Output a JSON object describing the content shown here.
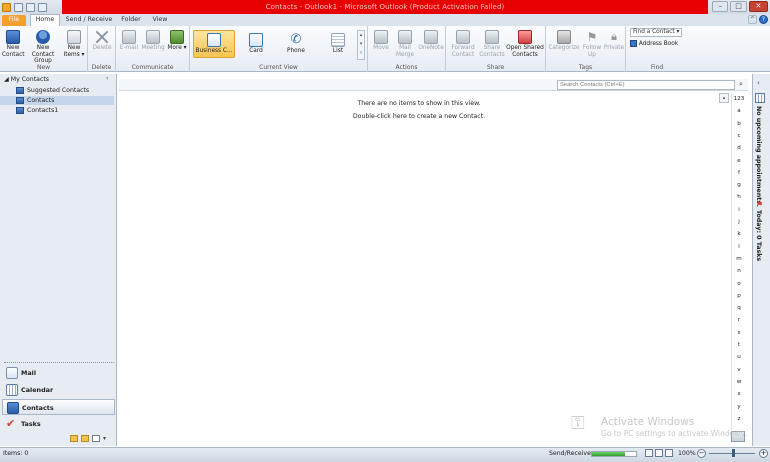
{
  "window": {
    "title": "Contacts - Outlook1 - Microsoft Outlook (Product Activation Failed)"
  },
  "tabs": [
    "File",
    "Home",
    "Send / Receive",
    "Folder",
    "View"
  ],
  "ribbon": {
    "new": {
      "new_contact": "New Contact",
      "new_group": "New Contact Group",
      "new_items": "New Items",
      "label": "New"
    },
    "delete": {
      "delete": "Delete",
      "label": "Delete"
    },
    "communicate": {
      "email": "E-mail",
      "meeting": "Meeting",
      "more": "More",
      "label": "Communicate"
    },
    "current_view": {
      "business_card": "Business C...",
      "card": "Card",
      "phone": "Phone",
      "list": "List",
      "label": "Current View"
    },
    "actions": {
      "move": "Move",
      "mail_merge": "Mail Merge",
      "onenote": "OneNote",
      "label": "Actions"
    },
    "share": {
      "forward_contact": "Forward Contact",
      "share_contacts": "Share Contacts",
      "open_shared": "Open Shared Contacts",
      "label": "Share"
    },
    "tags": {
      "categorize": "Categorize",
      "follow_up": "Follow Up",
      "private": "Private",
      "label": "Tags"
    },
    "find": {
      "find_contact": "Find a Contact",
      "address_book": "Address Book",
      "label": "Find"
    }
  },
  "nav": {
    "title": "My Contacts",
    "folders": [
      "Suggested Contacts",
      "Contacts",
      "Contacts1"
    ],
    "selected_folder": "Contacts",
    "buttons": [
      "Mail",
      "Calendar",
      "Contacts",
      "Tasks"
    ],
    "selected_button": "Contacts"
  },
  "main": {
    "search_placeholder": "Search Contacts (Ctrl+E)",
    "empty_message": "There are no items to show in this view.",
    "create_message": "Double-click here to create a new Contact.",
    "alphabet": [
      "123",
      "a",
      "b",
      "c",
      "d",
      "e",
      "f",
      "g",
      "h",
      "i",
      "j",
      "k",
      "l",
      "m",
      "n",
      "o",
      "p",
      "q",
      "r",
      "s",
      "t",
      "u",
      "v",
      "w",
      "x",
      "y",
      "z"
    ]
  },
  "todo_bar": {
    "appointments": "No upcoming appointments.",
    "tasks": "Today: 0 Tasks"
  },
  "watermark": {
    "line1": "Activate Windows",
    "line2": "Go to PC settings to activate Windows."
  },
  "status": {
    "items": "Items: 0",
    "send_receive": "Send/Receive",
    "progress_fraction": 0.75,
    "zoom": "100%"
  },
  "colors": {
    "title_band": "#e60000",
    "file_tab": "#f5a02c",
    "selected_view": "#f8c54d"
  }
}
